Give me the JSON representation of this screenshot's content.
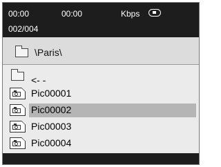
{
  "status": {
    "elapsed": "00:00",
    "total": "00:00",
    "bitrate_label": "Kbps",
    "playback_icon": "stop-icon",
    "track_counter": "002/004"
  },
  "path": {
    "icon": "folder-icon",
    "text": "\\Paris\\"
  },
  "files": {
    "parent": {
      "label": "<- -",
      "icon": "folder-icon"
    },
    "items": [
      {
        "label": "Pic00001",
        "icon": "photo-file-icon",
        "selected": false
      },
      {
        "label": "Pic00002",
        "icon": "photo-file-icon",
        "selected": true
      },
      {
        "label": "Pic00003",
        "icon": "photo-file-icon",
        "selected": false
      },
      {
        "label": "Pic00004",
        "icon": "photo-file-icon",
        "selected": false
      }
    ]
  },
  "colors": {
    "bar_background": "#1d1d1d",
    "panel_background": "#ebebeb",
    "path_background": "#dcdcdc",
    "selection": "#b5b5b5"
  }
}
